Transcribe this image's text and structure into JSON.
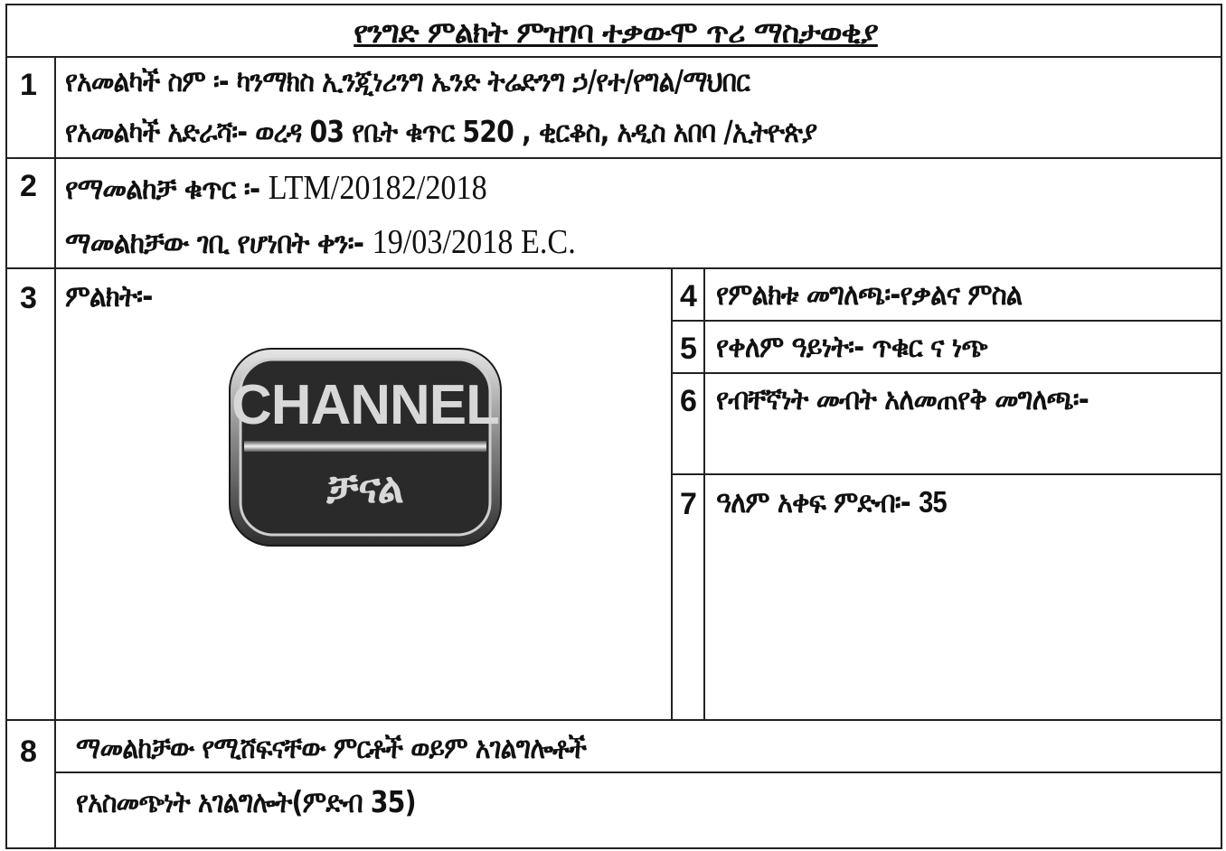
{
  "document": {
    "title": "የንግድ ምልክት ምዝገባ ተቃውሞ ጥሪ ማስታወቂያ"
  },
  "rows": {
    "r1": {
      "number": "1",
      "applicant_name_label": "የአመልካች ስም ፡-",
      "applicant_name": "ካንማክስ ኢንጂነሪንግ ኤንድ ትሬድንግ ኃ/የተ/የግል/ማህበር",
      "applicant_address_label": "የአመልካች አድራሻ፡-",
      "applicant_address": "ወረዳ 03 የቤት ቁጥር 520 ,  ቂርቆስ, አዲስ አበባ /ኢትዮጵያ"
    },
    "r2": {
      "number": "2",
      "app_number_label": "የማመልከቻ ቁጥር ፡-",
      "app_number": "LTM/20182/2018",
      "filing_date_label": "ማመልከቻው ገቢ የሆነበት ቀን፡-",
      "filing_date": "19/03/2018 E.C."
    },
    "r3": {
      "number": "3",
      "mark_label": "ምልክት፡-",
      "logo": {
        "line1": "CHANNEL",
        "line2": "ቻናል"
      }
    },
    "r4": {
      "number": "4",
      "text": "የምልክቱ መግለጫ፡-የቃልና ምስል"
    },
    "r5": {
      "number": "5",
      "text": "የቀለም ዓይነት፡-  ጥቁር ና ነጭ"
    },
    "r6": {
      "number": "6",
      "text": "የብቸኛነት መብት አለመጠየቅ መግለጫ፡-"
    },
    "r7": {
      "number": "7",
      "label": "ዓለም አቀፍ ምድብ፡-",
      "value": "35"
    },
    "r8": {
      "number": "8",
      "goods_label": "ማመልከቻው የሚሸፍናቸው ምርቶች ወይም አገልግሎቶች",
      "services": "የአስመጭነት አገልግሎት(ምድብ 35)"
    }
  }
}
